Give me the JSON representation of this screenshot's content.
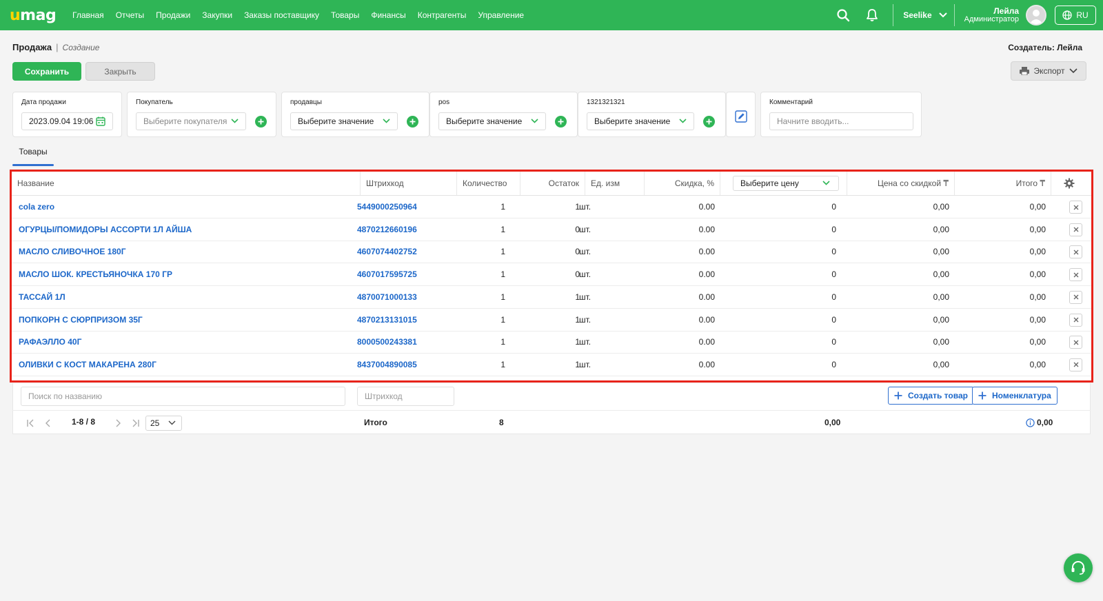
{
  "app": {
    "logo": "umag",
    "nav": [
      "Главная",
      "Отчеты",
      "Продажи",
      "Закупки",
      "Заказы поставщику",
      "Товары",
      "Финансы",
      "Контрагенты",
      "Управление"
    ],
    "company": "Seelike",
    "user_name": "Лейла",
    "user_role": "Администратор",
    "lang": "RU",
    "accent": "#2fb556"
  },
  "header": {
    "title": "Продажа",
    "subtitle": "Создание",
    "creator": "Создатель: Лейла",
    "save_label": "Сохранить",
    "close_label": "Закрыть",
    "export_label": "Экспорт"
  },
  "filters": {
    "date_label": "Дата продажи",
    "date_value": "2023.09.04 19:06",
    "buyer_label": "Покупатель",
    "buyer_placeholder": "Выберите покупателя",
    "sellers_label": "продавцы",
    "sellers_value": "Выберите значение",
    "pos_label": "pos",
    "pos_value": "Выберите значение",
    "custom_label": "1321321321",
    "custom_value": "Выберите значение",
    "comment_label": "Комментарий",
    "comment_placeholder": "Начните вводить..."
  },
  "tabs": [
    "Товары"
  ],
  "table": {
    "columns": {
      "name": "Название",
      "barcode": "Штрихкод",
      "qty": "Количество",
      "stock": "Остаток",
      "unit": "Ед. изм",
      "discount": "Скидка, %",
      "price_select": "Выберите цену",
      "discounted_price": "Цена со скидкой ₸",
      "total": "Итого ₸"
    },
    "rows": [
      {
        "name": "cola zero",
        "barcode": "5449000250964",
        "qty": "1",
        "stock": "1",
        "unit": "шт.",
        "discount": "0.00",
        "price": "0",
        "discounted": "0,00",
        "total": "0,00"
      },
      {
        "name": "ОГУРЦЫ/ПОМИДОРЫ АССОРТИ 1Л АЙША",
        "barcode": "4870212660196",
        "qty": "1",
        "stock": "0",
        "unit": "шт.",
        "discount": "0.00",
        "price": "0",
        "discounted": "0,00",
        "total": "0,00"
      },
      {
        "name": "МАСЛО СЛИВОЧНОЕ 180Г",
        "barcode": "4607074402752",
        "qty": "1",
        "stock": "0",
        "unit": "шт.",
        "discount": "0.00",
        "price": "0",
        "discounted": "0,00",
        "total": "0,00"
      },
      {
        "name": "МАСЛО ШОК. КРЕСТЬЯНОЧКА 170 ГР",
        "barcode": "4607017595725",
        "qty": "1",
        "stock": "0",
        "unit": "шт.",
        "discount": "0.00",
        "price": "0",
        "discounted": "0,00",
        "total": "0,00"
      },
      {
        "name": "ТАССАЙ 1Л",
        "barcode": "4870071000133",
        "qty": "1",
        "stock": "1",
        "unit": "шт.",
        "discount": "0.00",
        "price": "0",
        "discounted": "0,00",
        "total": "0,00"
      },
      {
        "name": "ПОПКОРН С СЮРПРИЗОМ 35Г",
        "barcode": "4870213131015",
        "qty": "1",
        "stock": "1",
        "unit": "шт.",
        "discount": "0.00",
        "price": "0",
        "discounted": "0,00",
        "total": "0,00"
      },
      {
        "name": "РАФАЭЛЛО 40Г",
        "barcode": "8000500243381",
        "qty": "1",
        "stock": "1",
        "unit": "шт.",
        "discount": "0.00",
        "price": "0",
        "discounted": "0,00",
        "total": "0,00"
      },
      {
        "name": "ОЛИВКИ С КОСТ МАКАРЕНА 280Г",
        "barcode": "8437004890085",
        "qty": "1",
        "stock": "1",
        "unit": "шт.",
        "discount": "0.00",
        "price": "0",
        "discounted": "0,00",
        "total": "0,00"
      }
    ]
  },
  "under": {
    "search_placeholder": "Поиск по названию",
    "barcode_placeholder": "Штрихкод",
    "create_product": "Создать товар",
    "nomenclature": "Номенклатура"
  },
  "footer": {
    "range": "1-8 / 8",
    "per_page": "25",
    "total_label": "Итого",
    "total_qty": "8",
    "total_price": "0,00",
    "total_sum": "0,00"
  }
}
